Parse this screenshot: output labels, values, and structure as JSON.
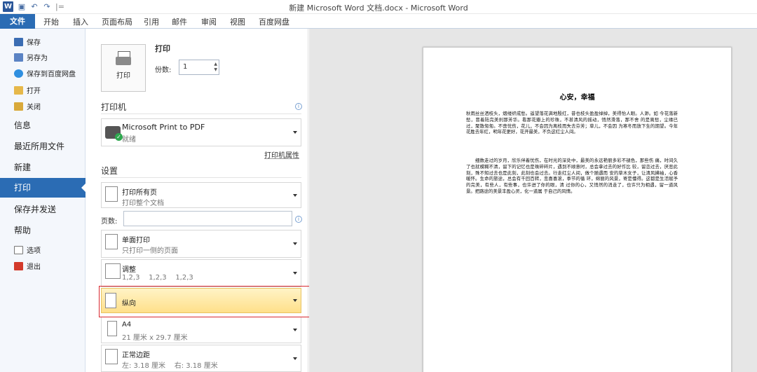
{
  "titlebar": {
    "title": "新建 Microsoft Word 文档.docx - Microsoft Word",
    "logo": "W",
    "qat_icons": [
      "save-icon",
      "undo-icon",
      "redo-icon",
      "customize-icon"
    ]
  },
  "ribbon": {
    "tabs": [
      "文件",
      "开始",
      "插入",
      "页面布局",
      "引用",
      "邮件",
      "审阅",
      "视图",
      "百度网盘"
    ]
  },
  "nav": {
    "save": "保存",
    "save_as": "另存为",
    "save_baidu": "保存到百度网盘",
    "open": "打开",
    "close": "关闭",
    "info": "信息",
    "recent": "最近所用文件",
    "new": "新建",
    "print": "打印",
    "save_send": "保存并发送",
    "help": "帮助",
    "options": "选项",
    "exit": "退出"
  },
  "print": {
    "button": "打印",
    "header": "打印",
    "copies_label": "份数:",
    "copies_value": "1",
    "printer_header": "打印机",
    "printer_name": "Microsoft Print to PDF",
    "printer_status": "就绪",
    "printer_props": "打印机属性",
    "settings_header": "设置",
    "pages_label": "页数:",
    "pages_value": "",
    "options": [
      {
        "t1": "打印所有页",
        "t2": "打印整个文档"
      },
      {
        "t1": "单面打印",
        "t2": "只打印一侧的页面"
      },
      {
        "t1": "调整",
        "t2": "1,2,3    1,2,3    1,2,3"
      },
      {
        "t1": "纵向",
        "t2": ""
      },
      {
        "t1": "A4",
        "t2": "21 厘米 x 29.7 厘米"
      },
      {
        "t1": "正常边距",
        "t2": "左: 3.18 厘米    右: 3.18 厘米"
      }
    ]
  },
  "preview": {
    "doc_title": "心安，幸福",
    "para1": "秋雨丝丝洒枝头，烟缕织成愁。遥望落花满地殷红，昔也枝头盈盈绰绰，美得怡人眼。人渺。如 今花落新愁，冒着陆完美刹那芳华。看那花瓣上的珍珠，不甚清风的摇动，悄然滑落，那不舍 的是离愁，尘缘已过，聚散匆匆。不啻忧伤，花儿，不会因为离枝而失去芬芳；草儿，不会因 为寒冬而放下生的期望。今年花胜去年红，明年花更好，花开最美，不负这红尘人间。",
    "para2": "细数走过的岁月，欣乐伴着忧伤，在时光的深处中，最美的永远艳丽多彩不褪色，那些伤 痛，时间久了也就模糊不清，留下的记忆也是珠碎碎片，遇到不顺意时，总会拿过去的好作比 较，留恋过去，厌恶此刻，殊不知过去也是此刻，此刻也会过去。行走红尘人间，做个随遇而 安的草木女子，让清风拂袖，心香暖怀。生命的旅途，总会有千回百转，悲喜喜滚，季节的循 环，绵丽的风景，寄是懂得。这都是生活赋予的完美，有些人，有些事，也许进了你的眼，清 过你的心，又悄然的消走了，也许只为相遇，留一道风景。把路途的美景丰盈心灵，化一道属 于自己的风情。"
  }
}
